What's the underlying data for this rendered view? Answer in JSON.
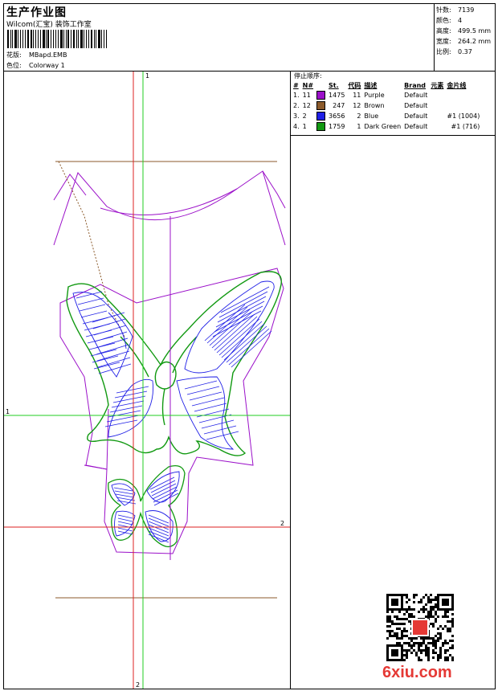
{
  "header": {
    "title": "生产作业图",
    "company": "Wilcom(汇宝) 装饰工作室",
    "design_label": "花版:",
    "design_value": "MBapd.EMB",
    "colorway_label": "色位:",
    "colorway_value": "Colorway 1"
  },
  "info": {
    "stitches_label": "针数:",
    "stitches_value": "7139",
    "colors_label": "颜色:",
    "colors_value": "4",
    "height_label": "高度:",
    "height_value": "499.5 mm",
    "width_label": "宽度:",
    "width_value": "264.2 mm",
    "scale_label": "比例:",
    "scale_value": "0.37"
  },
  "stops": {
    "title": "停止顺序:",
    "headers": [
      "#",
      "N#",
      "St.",
      "代码",
      "描述",
      "Brand",
      "元素",
      "金片线"
    ],
    "rows": [
      {
        "idx": "1.",
        "needle": "11",
        "color": "#9b10c9",
        "st": "1475",
        "code": "11",
        "desc": "Purple",
        "brand": "Default",
        "elem": "",
        "seq": ""
      },
      {
        "idx": "2.",
        "needle": "12",
        "color": "#8b5a2b",
        "st": "247",
        "code": "12",
        "desc": "Brown",
        "brand": "Default",
        "elem": "",
        "seq": ""
      },
      {
        "idx": "3.",
        "needle": "2",
        "color": "#1f1fe6",
        "st": "3656",
        "code": "2",
        "desc": "Blue",
        "brand": "Default",
        "elem": "",
        "seq": "#1 (1004)"
      },
      {
        "idx": "4.",
        "needle": "1",
        "color": "#119911",
        "st": "1759",
        "code": "1",
        "desc": "Dark Green",
        "brand": "Default",
        "elem": "",
        "seq": "#1 (716)"
      }
    ]
  },
  "axes": {
    "v1": "1",
    "h1": "1",
    "v2": "2",
    "h2": "2"
  },
  "watermark": {
    "logo_text": "6xiu.com"
  }
}
